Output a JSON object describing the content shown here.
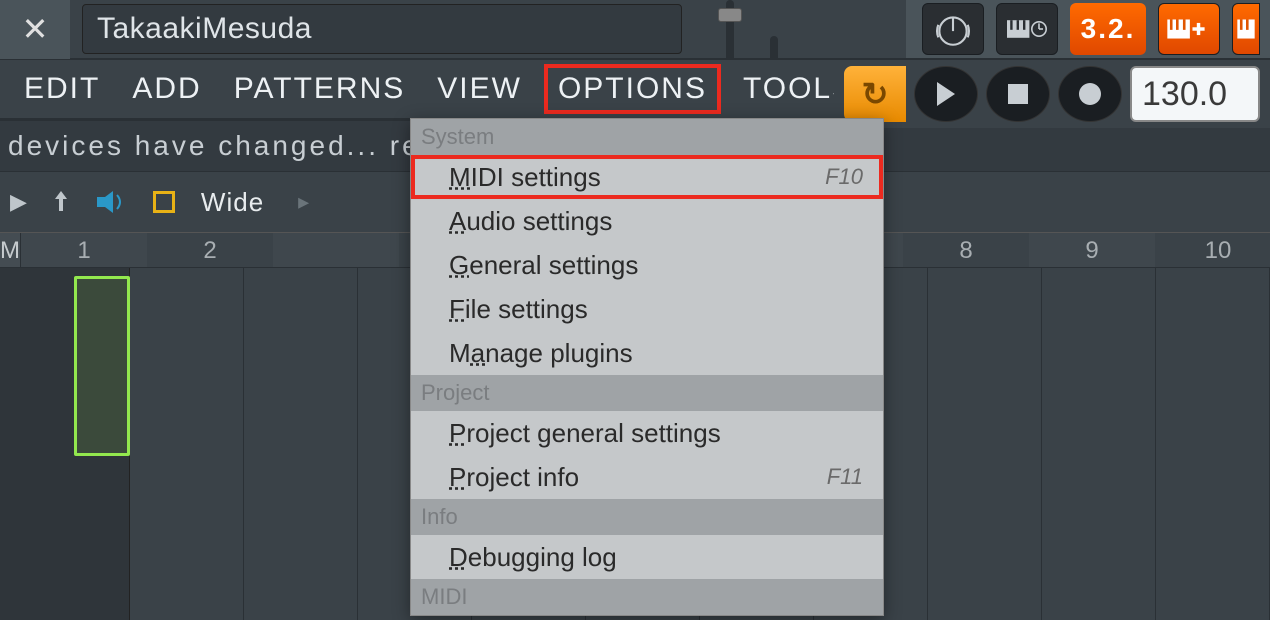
{
  "window": {
    "title": "TakaakiMesuda"
  },
  "menu": {
    "items": [
      "EDIT",
      "ADD",
      "PATTERNS",
      "VIEW",
      "OPTIONS",
      "TOOLS",
      "?"
    ],
    "active": "OPTIONS"
  },
  "toolbar": {
    "segment_display": "3.2.",
    "tempo": "130.0"
  },
  "status": {
    "text": "devices have changed... refre"
  },
  "channel": {
    "label": "Wide"
  },
  "ruler": {
    "m_label": "M",
    "numbers": [
      "1",
      "2",
      "",
      "",
      "",
      "",
      "",
      "8",
      "9",
      "10"
    ]
  },
  "dropdown": {
    "sections": [
      {
        "title": "System",
        "items": [
          {
            "label": "MIDI settings",
            "underline": 0,
            "shortcut": "F10",
            "highlighted": true
          },
          {
            "label": "Audio settings",
            "underline": 0
          },
          {
            "label": "General settings",
            "underline": 0
          },
          {
            "label": "File settings",
            "underline": 0
          },
          {
            "label": "Manage plugins",
            "underline": 1
          }
        ]
      },
      {
        "title": "Project",
        "items": [
          {
            "label": "Project general settings",
            "underline": 0
          },
          {
            "label": "Project info",
            "underline": 0,
            "shortcut": "F11"
          }
        ]
      },
      {
        "title": "Info",
        "items": [
          {
            "label": "Debugging log",
            "underline": 0
          }
        ]
      },
      {
        "title": "MIDI",
        "items": []
      }
    ]
  }
}
